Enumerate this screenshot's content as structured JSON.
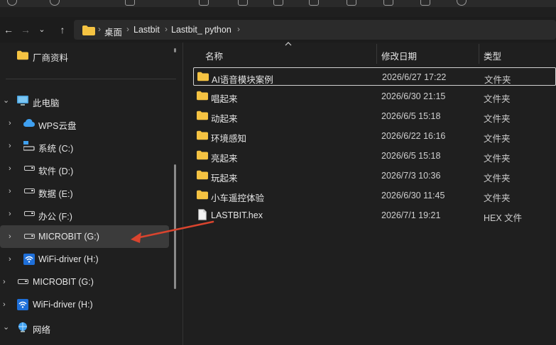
{
  "address_bar": {
    "back_icon": "arrow-left-icon",
    "forward_icon": "arrow-right-icon",
    "recent_icon": "chevron-down-icon",
    "up_icon": "arrow-up-icon",
    "breadcrumbs": [
      "桌面",
      "Lastbit",
      "Lastbit_ python"
    ]
  },
  "nav_pane": {
    "quick_access": [
      {
        "label": "厂商资料"
      }
    ],
    "this_pc_label": "此电脑",
    "this_pc_children": [
      {
        "label": "WPS云盘",
        "icon": "cloud-icon"
      },
      {
        "label": "系统 (C:)",
        "icon": "system-drive-icon"
      },
      {
        "label": "软件 (D:)",
        "icon": "drive-icon"
      },
      {
        "label": "数据 (E:)",
        "icon": "drive-icon"
      },
      {
        "label": "办公 (F:)",
        "icon": "drive-icon"
      },
      {
        "label": "MICROBIT (G:)",
        "icon": "drive-icon",
        "selected": true
      },
      {
        "label": "WiFi-driver (H:)",
        "icon": "wifi-drive-icon"
      }
    ],
    "top_level": [
      {
        "label": "MICROBIT (G:)",
        "icon": "drive-icon"
      },
      {
        "label": "WiFi-driver (H:)",
        "icon": "wifi-drive-icon"
      },
      {
        "label": "网络",
        "icon": "network-icon"
      }
    ]
  },
  "file_list": {
    "columns": {
      "name": "名称",
      "date": "修改日期",
      "type": "类型"
    },
    "rows": [
      {
        "name": "AI语音模块案例",
        "date": "2026/6/27 17:22",
        "type": "文件夹",
        "kind": "folder"
      },
      {
        "name": "唱起来",
        "date": "2026/6/30 21:15",
        "type": "文件夹",
        "kind": "folder"
      },
      {
        "name": "动起来",
        "date": "2026/6/5 15:18",
        "type": "文件夹",
        "kind": "folder"
      },
      {
        "name": "环境感知",
        "date": "2026/6/22 16:16",
        "type": "文件夹",
        "kind": "folder"
      },
      {
        "name": "亮起来",
        "date": "2026/6/5 15:18",
        "type": "文件夹",
        "kind": "folder"
      },
      {
        "name": "玩起来",
        "date": "2026/7/3 10:36",
        "type": "文件夹",
        "kind": "folder"
      },
      {
        "name": "小车遥控体验",
        "date": "2026/6/30 11:45",
        "type": "文件夹",
        "kind": "folder"
      },
      {
        "name": "LASTBIT.hex",
        "date": "2026/7/1 19:21",
        "type": "HEX 文件",
        "kind": "file"
      }
    ]
  },
  "colors": {
    "folder": "#f5c342",
    "arrow": "#d9442e",
    "selected_bg": "#3b3b3b"
  }
}
